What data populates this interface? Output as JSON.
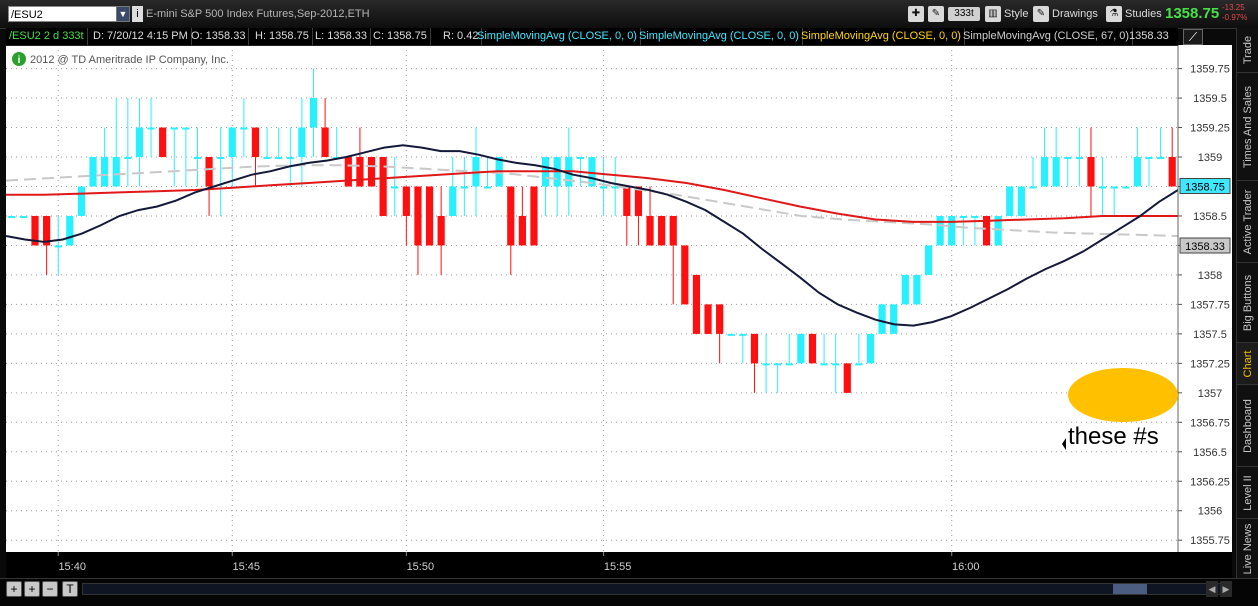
{
  "toolbar": {
    "symbol": "/ESU2",
    "instrument": "E-mini S&P 500 Index Futures,Sep-2012,ETH",
    "timeframe": "333t",
    "style_label": "Style",
    "drawings_label": "Drawings",
    "studies_label": "Studies",
    "last_price": "1358.75",
    "change_points": "-13.25",
    "change_percent": "-0.97%"
  },
  "status": {
    "symbol_period": "/ESU2 2 d 333t",
    "date": "D: 7/20/12 4:15 PM",
    "open": "O: 1358.33",
    "high": "H: 1358.75",
    "low": "L: 1358.33",
    "close": "C: 1358.75",
    "range": "R: 0.42",
    "studies": [
      {
        "label": "SimpleMovingAvg (CLOSE, 0, 0)",
        "color": "#40e8ff"
      },
      {
        "label": "SimpleMovingAvg (CLOSE, 0, 0)",
        "color": "#40e8ff"
      },
      {
        "label": "SimpleMovingAvg (CLOSE, 0, 0)",
        "color": "#ffd800"
      },
      {
        "label": "SimpleMovingAvg (CLOSE, 67, 0)",
        "color": "#d0d0d0"
      }
    ],
    "last_study_value": "1358.33"
  },
  "chart_data": {
    "type": "candlestick",
    "copyright": "2012 @ TD Ameritrade IP Company, Inc.",
    "ylim": [
      1355.65,
      1359.95
    ],
    "y_ticks": [
      "1359.75",
      "1359.5",
      "1359.25",
      "1359",
      "1358.75",
      "1358.5",
      "1358.25",
      "1358",
      "1357.75",
      "1357.5",
      "1357.25",
      "1357",
      "1356.75",
      "1356.5",
      "1356.25",
      "1356",
      "1355.75"
    ],
    "x_ticks": [
      {
        "label": "15:40",
        "bar": 4
      },
      {
        "label": "15:45",
        "bar": 19
      },
      {
        "label": "15:50",
        "bar": 34
      },
      {
        "label": "15:55",
        "bar": 51
      },
      {
        "label": "16:00",
        "bar": 81
      }
    ],
    "candles": [
      [
        1358.5,
        1358.5,
        1358.5,
        1358.5
      ],
      [
        1358.5,
        1358.5,
        1358.5,
        1358.5
      ],
      [
        1358.5,
        1358.5,
        1358.25,
        1358.25
      ],
      [
        1358.5,
        1358.5,
        1358.0,
        1358.25
      ],
      [
        1358.25,
        1358.5,
        1358.0,
        1358.25
      ],
      [
        1358.25,
        1358.5,
        1358.25,
        1358.5
      ],
      [
        1358.5,
        1358.75,
        1358.5,
        1358.75
      ],
      [
        1358.75,
        1359.0,
        1358.75,
        1359.0
      ],
      [
        1358.75,
        1359.25,
        1358.75,
        1359.0
      ],
      [
        1358.75,
        1359.5,
        1358.75,
        1359.0
      ],
      [
        1359.0,
        1359.5,
        1358.75,
        1359.0
      ],
      [
        1359.0,
        1359.5,
        1358.75,
        1359.25
      ],
      [
        1359.25,
        1359.5,
        1359.0,
        1359.25
      ],
      [
        1359.25,
        1359.25,
        1359.0,
        1359.0
      ],
      [
        1359.25,
        1359.25,
        1358.75,
        1359.25
      ],
      [
        1359.25,
        1359.25,
        1358.75,
        1359.25
      ],
      [
        1359.0,
        1359.25,
        1358.75,
        1359.0
      ],
      [
        1359.0,
        1359.0,
        1358.5,
        1358.75
      ],
      [
        1359.0,
        1359.25,
        1358.5,
        1359.0
      ],
      [
        1359.0,
        1359.25,
        1358.75,
        1359.25
      ],
      [
        1359.25,
        1359.5,
        1359.0,
        1359.25
      ],
      [
        1359.25,
        1359.25,
        1358.75,
        1359.0
      ],
      [
        1359.0,
        1359.25,
        1359.0,
        1359.0
      ],
      [
        1359.0,
        1359.25,
        1359.0,
        1359.0
      ],
      [
        1359.0,
        1359.25,
        1358.75,
        1359.0
      ],
      [
        1359.0,
        1359.5,
        1358.75,
        1359.25
      ],
      [
        1359.25,
        1359.75,
        1359.0,
        1359.5
      ],
      [
        1359.25,
        1359.5,
        1359.0,
        1359.0
      ],
      [
        1359.0,
        1359.25,
        1359.0,
        1359.0
      ],
      [
        1359.0,
        1359.0,
        1358.75,
        1358.75
      ],
      [
        1359.0,
        1359.25,
        1358.75,
        1358.75
      ],
      [
        1359.0,
        1359.0,
        1358.75,
        1358.75
      ],
      [
        1359.0,
        1359.0,
        1358.5,
        1358.5
      ],
      [
        1358.75,
        1359.0,
        1358.5,
        1358.75
      ],
      [
        1358.75,
        1358.75,
        1358.25,
        1358.5
      ],
      [
        1358.75,
        1358.75,
        1358.0,
        1358.25
      ],
      [
        1358.75,
        1358.75,
        1358.25,
        1358.25
      ],
      [
        1358.5,
        1358.75,
        1358.0,
        1358.25
      ],
      [
        1358.5,
        1359.0,
        1358.5,
        1358.75
      ],
      [
        1358.75,
        1359.0,
        1358.5,
        1358.75
      ],
      [
        1358.75,
        1359.25,
        1358.5,
        1359.0
      ],
      [
        1358.75,
        1359.0,
        1358.75,
        1358.75
      ],
      [
        1358.75,
        1359.0,
        1358.75,
        1359.0
      ],
      [
        1358.75,
        1358.75,
        1358.0,
        1358.25
      ],
      [
        1358.5,
        1358.75,
        1358.25,
        1358.25
      ],
      [
        1358.75,
        1358.75,
        1358.25,
        1358.25
      ],
      [
        1358.75,
        1359.0,
        1358.5,
        1359.0
      ],
      [
        1358.75,
        1359.0,
        1358.5,
        1359.0
      ],
      [
        1358.75,
        1359.25,
        1358.5,
        1359.0
      ],
      [
        1359.0,
        1359.0,
        1358.75,
        1359.0
      ],
      [
        1358.75,
        1359.0,
        1358.75,
        1359.0
      ],
      [
        1358.75,
        1359.0,
        1358.5,
        1358.75
      ],
      [
        1358.75,
        1359.0,
        1358.5,
        1358.75
      ],
      [
        1358.75,
        1358.75,
        1358.25,
        1358.5
      ],
      [
        1358.75,
        1358.75,
        1358.25,
        1358.5
      ],
      [
        1358.5,
        1358.75,
        1358.25,
        1358.25
      ],
      [
        1358.5,
        1358.5,
        1358.25,
        1358.25
      ],
      [
        1358.5,
        1358.5,
        1357.75,
        1358.25
      ],
      [
        1358.25,
        1358.25,
        1357.75,
        1357.75
      ],
      [
        1358.0,
        1358.0,
        1357.5,
        1357.5
      ],
      [
        1357.75,
        1357.75,
        1357.5,
        1357.5
      ],
      [
        1357.75,
        1357.75,
        1357.25,
        1357.5
      ],
      [
        1357.5,
        1357.5,
        1357.5,
        1357.5
      ],
      [
        1357.5,
        1357.5,
        1357.25,
        1357.5
      ],
      [
        1357.5,
        1357.5,
        1357.0,
        1357.25
      ],
      [
        1357.25,
        1357.5,
        1357.0,
        1357.25
      ],
      [
        1357.25,
        1357.25,
        1357.0,
        1357.25
      ],
      [
        1357.25,
        1357.5,
        1357.25,
        1357.25
      ],
      [
        1357.25,
        1357.5,
        1357.25,
        1357.5
      ],
      [
        1357.5,
        1357.5,
        1357.25,
        1357.25
      ],
      [
        1357.25,
        1357.5,
        1357.25,
        1357.25
      ],
      [
        1357.25,
        1357.5,
        1357.0,
        1357.25
      ],
      [
        1357.25,
        1357.25,
        1357.0,
        1357.0
      ],
      [
        1357.25,
        1357.5,
        1357.25,
        1357.25
      ],
      [
        1357.25,
        1357.5,
        1357.25,
        1357.5
      ],
      [
        1357.5,
        1357.75,
        1357.5,
        1357.75
      ],
      [
        1357.5,
        1357.75,
        1357.5,
        1357.75
      ],
      [
        1357.75,
        1358.0,
        1357.75,
        1358.0
      ],
      [
        1357.75,
        1358.0,
        1357.75,
        1358.0
      ],
      [
        1358.0,
        1358.25,
        1358.0,
        1358.25
      ],
      [
        1358.25,
        1358.5,
        1358.25,
        1358.5
      ],
      [
        1358.25,
        1358.5,
        1358.25,
        1358.5
      ],
      [
        1358.5,
        1358.5,
        1358.25,
        1358.5
      ],
      [
        1358.5,
        1358.5,
        1358.25,
        1358.5
      ],
      [
        1358.5,
        1358.5,
        1358.25,
        1358.25
      ],
      [
        1358.25,
        1358.5,
        1358.25,
        1358.5
      ],
      [
        1358.5,
        1358.75,
        1358.5,
        1358.75
      ],
      [
        1358.5,
        1358.75,
        1358.5,
        1358.75
      ],
      [
        1358.75,
        1359.0,
        1358.75,
        1358.75
      ],
      [
        1358.75,
        1359.25,
        1358.75,
        1359.0
      ],
      [
        1358.75,
        1359.25,
        1358.75,
        1359.0
      ],
      [
        1359.0,
        1359.0,
        1358.75,
        1359.0
      ],
      [
        1359.0,
        1359.25,
        1358.75,
        1359.0
      ],
      [
        1359.0,
        1359.25,
        1358.5,
        1358.75
      ],
      [
        1358.75,
        1359.0,
        1358.5,
        1358.75
      ],
      [
        1358.75,
        1358.75,
        1358.5,
        1358.75
      ],
      [
        1358.75,
        1358.75,
        1358.75,
        1358.75
      ],
      [
        1358.75,
        1359.25,
        1358.75,
        1359.0
      ],
      [
        1359.0,
        1359.0,
        1358.75,
        1359.0
      ],
      [
        1359.0,
        1359.25,
        1359.0,
        1359.0
      ],
      [
        1359.0,
        1359.25,
        1358.75,
        1358.75
      ]
    ],
    "series": [
      {
        "color": "#14193a",
        "values": [
          1358.33,
          1358.3,
          1358.28,
          1358.3,
          1358.35,
          1358.42,
          1358.5,
          1358.55,
          1358.58,
          1358.63,
          1358.7,
          1358.75,
          1358.8,
          1358.85,
          1358.88,
          1358.92,
          1358.95,
          1358.97,
          1359.0,
          1359.04,
          1359.08,
          1359.1,
          1359.08,
          1359.05,
          1359.05,
          1359.02,
          1358.98,
          1358.95,
          1358.93,
          1358.9,
          1358.85,
          1358.82,
          1358.78,
          1358.75,
          1358.72,
          1358.68,
          1358.62,
          1358.55,
          1358.45,
          1358.35,
          1358.22,
          1358.1,
          1357.98,
          1357.85,
          1357.75,
          1357.68,
          1357.62,
          1357.58,
          1357.57,
          1357.6,
          1357.65,
          1357.72,
          1357.8,
          1357.88,
          1357.97,
          1358.05,
          1358.12,
          1358.2,
          1358.3,
          1358.4,
          1358.5,
          1358.62,
          1358.72
        ]
      },
      {
        "color": "#e01818",
        "values": [
          1358.68,
          1358.68,
          1358.69,
          1358.7,
          1358.71,
          1358.72,
          1358.74,
          1358.76,
          1358.78,
          1358.8,
          1358.82,
          1358.84,
          1358.86,
          1358.88,
          1358.88,
          1358.88,
          1358.85,
          1358.82,
          1358.78,
          1358.72,
          1358.65,
          1358.58,
          1358.52,
          1358.47,
          1358.45,
          1358.45,
          1358.46,
          1358.47,
          1358.48,
          1358.5,
          1358.5,
          1358.5
        ]
      },
      {
        "color": "#c8c8c8",
        "values": [
          1358.8,
          1358.82,
          1358.84,
          1358.86,
          1358.88,
          1358.9,
          1358.92,
          1358.93,
          1358.93,
          1358.92,
          1358.9,
          1358.88,
          1358.86,
          1358.82,
          1358.78,
          1358.73,
          1358.68,
          1358.62,
          1358.56,
          1358.5,
          1358.47,
          1358.45,
          1358.43,
          1358.4,
          1358.38,
          1358.36,
          1358.35,
          1358.34,
          1358.33
        ]
      }
    ],
    "price_labels": [
      {
        "text": "1358.75",
        "value": 1358.75,
        "fill": "#40e8ff"
      },
      {
        "text": "1358.33",
        "value": 1358.33,
        "fill": "#c8c8c8"
      }
    ],
    "annotation": {
      "text": "these #s",
      "fill": "#ffc000"
    }
  },
  "sidebar": {
    "tabs": [
      {
        "label": "Trade",
        "active": false
      },
      {
        "label": "Times And Sales",
        "active": false
      },
      {
        "label": "Active Trader",
        "active": false
      },
      {
        "label": "Big Buttons",
        "active": false
      },
      {
        "label": "Chart",
        "active": true
      },
      {
        "label": "Dashboard",
        "active": false
      },
      {
        "label": "Level II",
        "active": false
      },
      {
        "label": "Live News",
        "active": false
      }
    ]
  },
  "bottom": {
    "zoom_in": "+",
    "zoom_other": "+",
    "zoom_out": "−",
    "text_tool": "T"
  }
}
